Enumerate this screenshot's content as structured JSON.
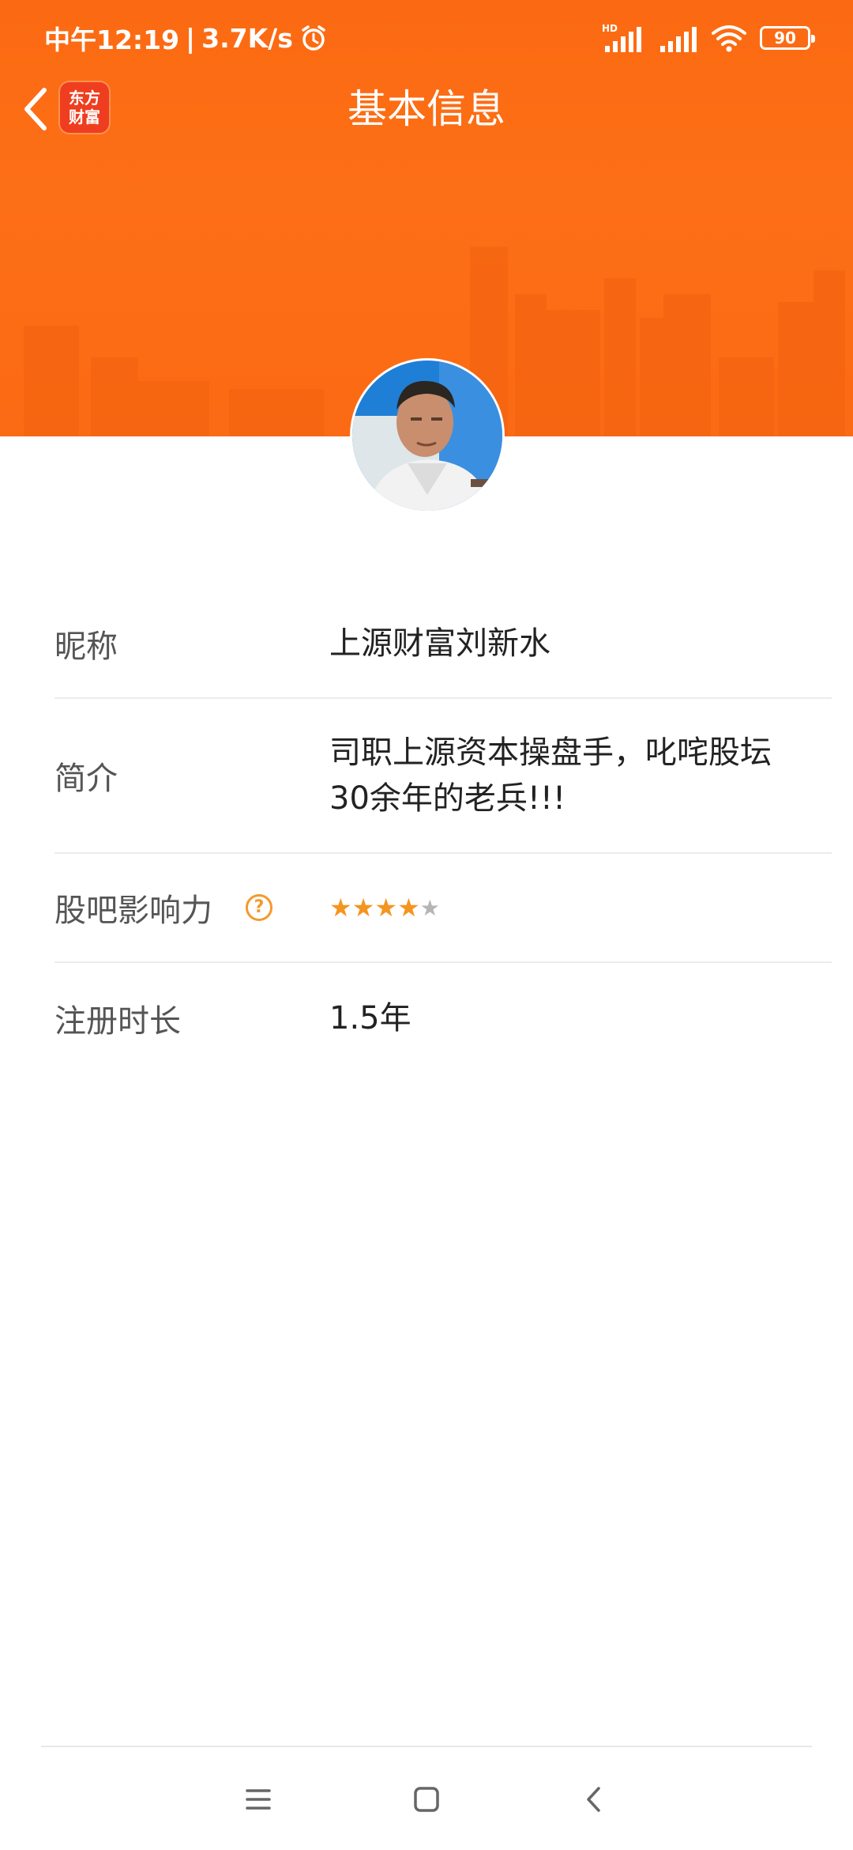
{
  "status_bar": {
    "time": "中午12:19",
    "separator": "|",
    "network_speed": "3.7K/s",
    "battery": "90",
    "icons": [
      "alarm-icon",
      "hd-signal-icon",
      "signal-icon",
      "wifi-icon",
      "battery-icon"
    ]
  },
  "nav": {
    "title": "基本信息",
    "logo_line1": "东方",
    "logo_line2": "财富"
  },
  "profile": {
    "rows": {
      "nickname": {
        "label": "昵称",
        "value": "上源财富刘新水"
      },
      "intro": {
        "label": "简介",
        "value_line1": "司职上源资本操盘手，叱咤股坛",
        "value_line2": "30余年的老兵!!!"
      },
      "influence": {
        "label": "股吧影响力",
        "help": "?",
        "rating": 4,
        "max_rating": 5
      },
      "reg_time": {
        "label": "注册时长",
        "value": "1.5年"
      }
    }
  },
  "colors": {
    "header": "#fd6f16",
    "accent": "#f39a2c",
    "star_on": "#f5951f",
    "star_off": "#b5b5b5"
  }
}
